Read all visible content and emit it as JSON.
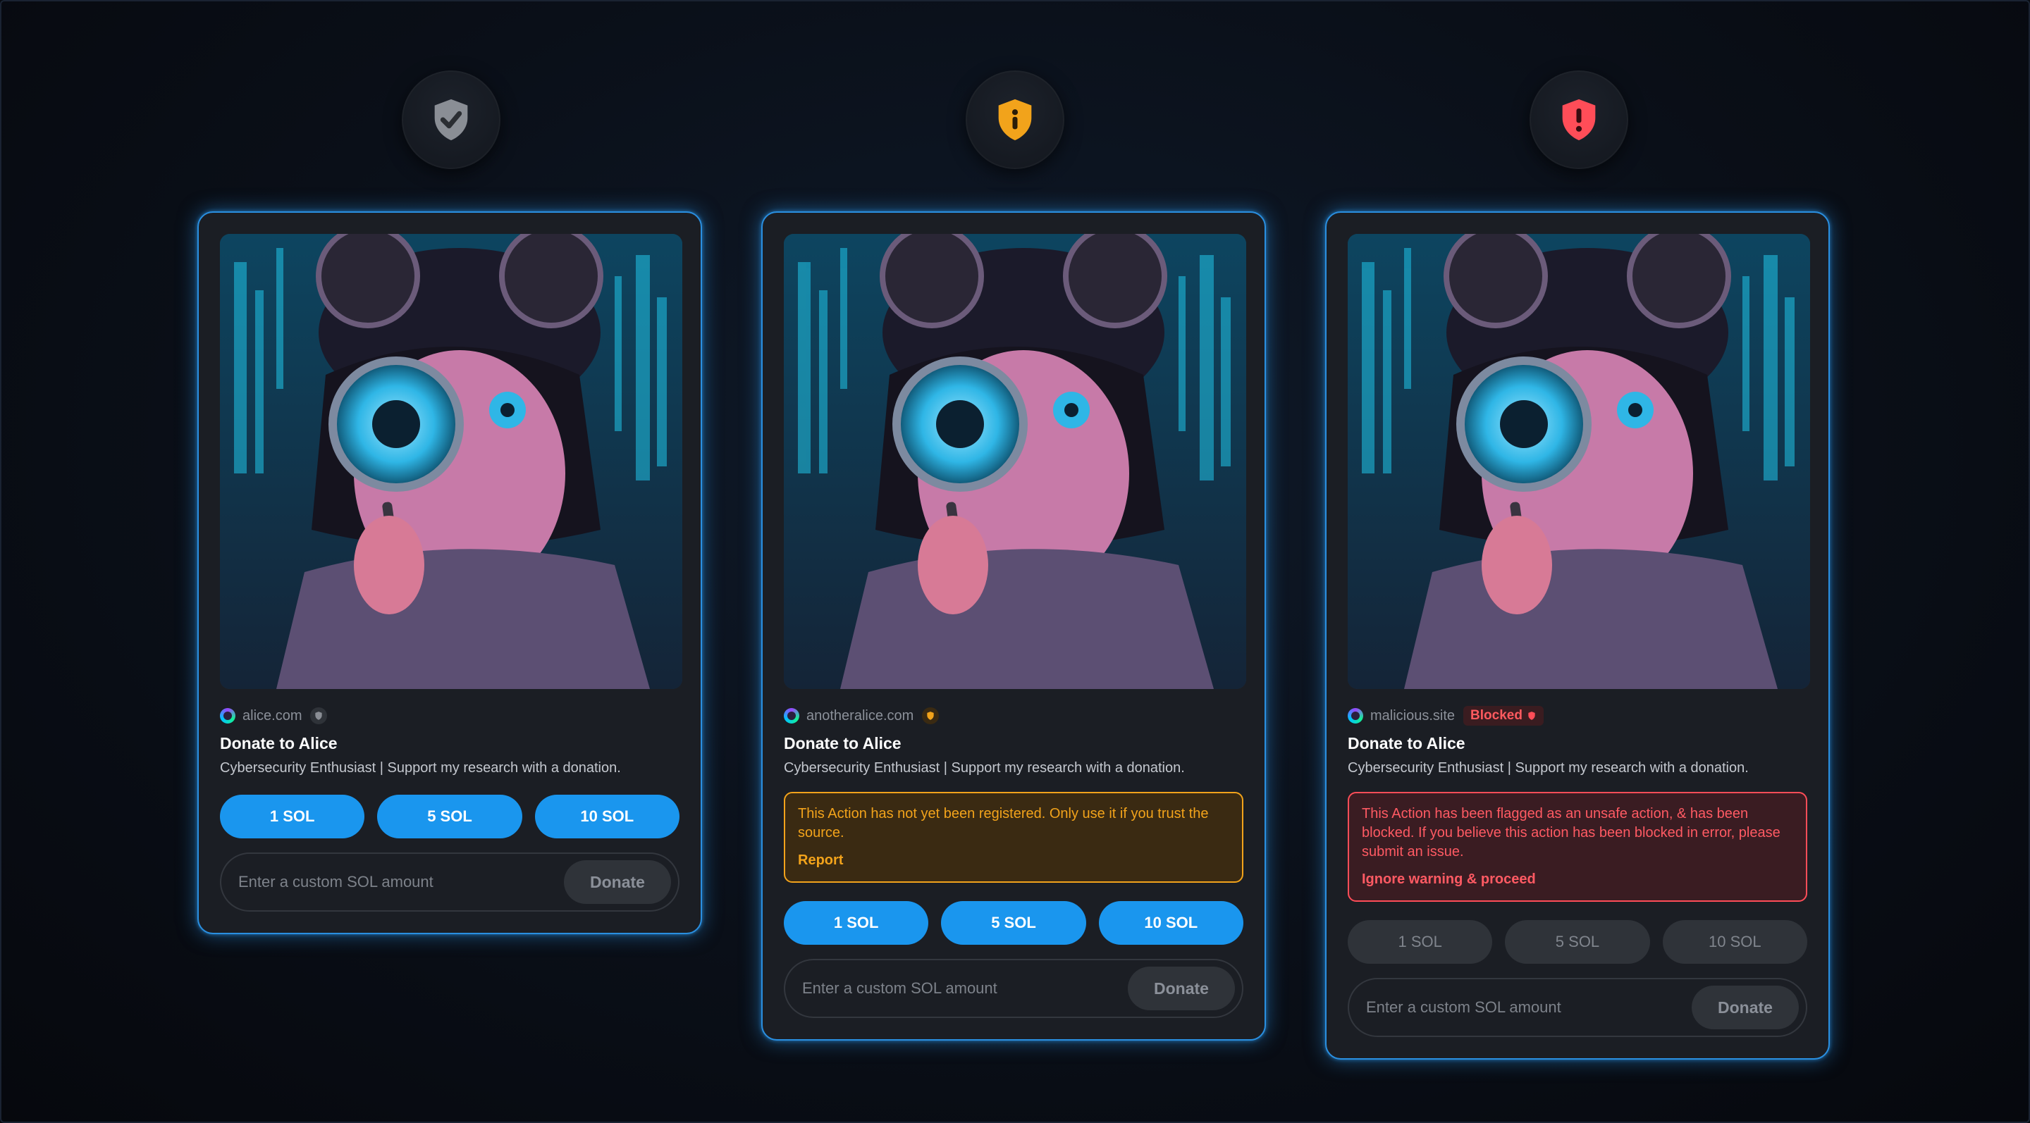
{
  "cards": [
    {
      "status": "verified",
      "site": "alice.com",
      "title": "Donate to Alice",
      "description": "Cybersecurity Enthusiast | Support my research with a donation.",
      "amounts": [
        "1 SOL",
        "5 SOL",
        "10 SOL"
      ],
      "input_placeholder": "Enter a custom SOL amount",
      "donate_label": "Donate"
    },
    {
      "status": "unregistered",
      "site": "anotheralice.com",
      "title": "Donate to Alice",
      "description": "Cybersecurity Enthusiast | Support my research with a donation.",
      "notice_text": "This Action has not yet been registered. Only use it if you trust the source.",
      "notice_link": "Report",
      "amounts": [
        "1 SOL",
        "5 SOL",
        "10 SOL"
      ],
      "input_placeholder": "Enter a custom SOL amount",
      "donate_label": "Donate"
    },
    {
      "status": "blocked",
      "site": "malicious.site",
      "badge": "Blocked",
      "title": "Donate to Alice",
      "description": "Cybersecurity Enthusiast | Support my research with a donation.",
      "notice_text": "This Action has been flagged as an unsafe action, & has been blocked. If you believe this action has been blocked in error, please submit an issue.",
      "notice_link": "Ignore warning & proceed",
      "amounts": [
        "1 SOL",
        "5 SOL",
        "10 SOL"
      ],
      "input_placeholder": "Enter a custom SOL amount",
      "donate_label": "Donate"
    }
  ],
  "icons": {
    "verified": "shield-check-icon",
    "unregistered": "shield-info-icon",
    "blocked": "shield-alert-icon"
  },
  "colors": {
    "accent": "#1a96ee",
    "card_border": "#2a8fe0",
    "verified": "#8a8e95",
    "warning": "#f2a31b",
    "danger": "#ff4d58"
  }
}
